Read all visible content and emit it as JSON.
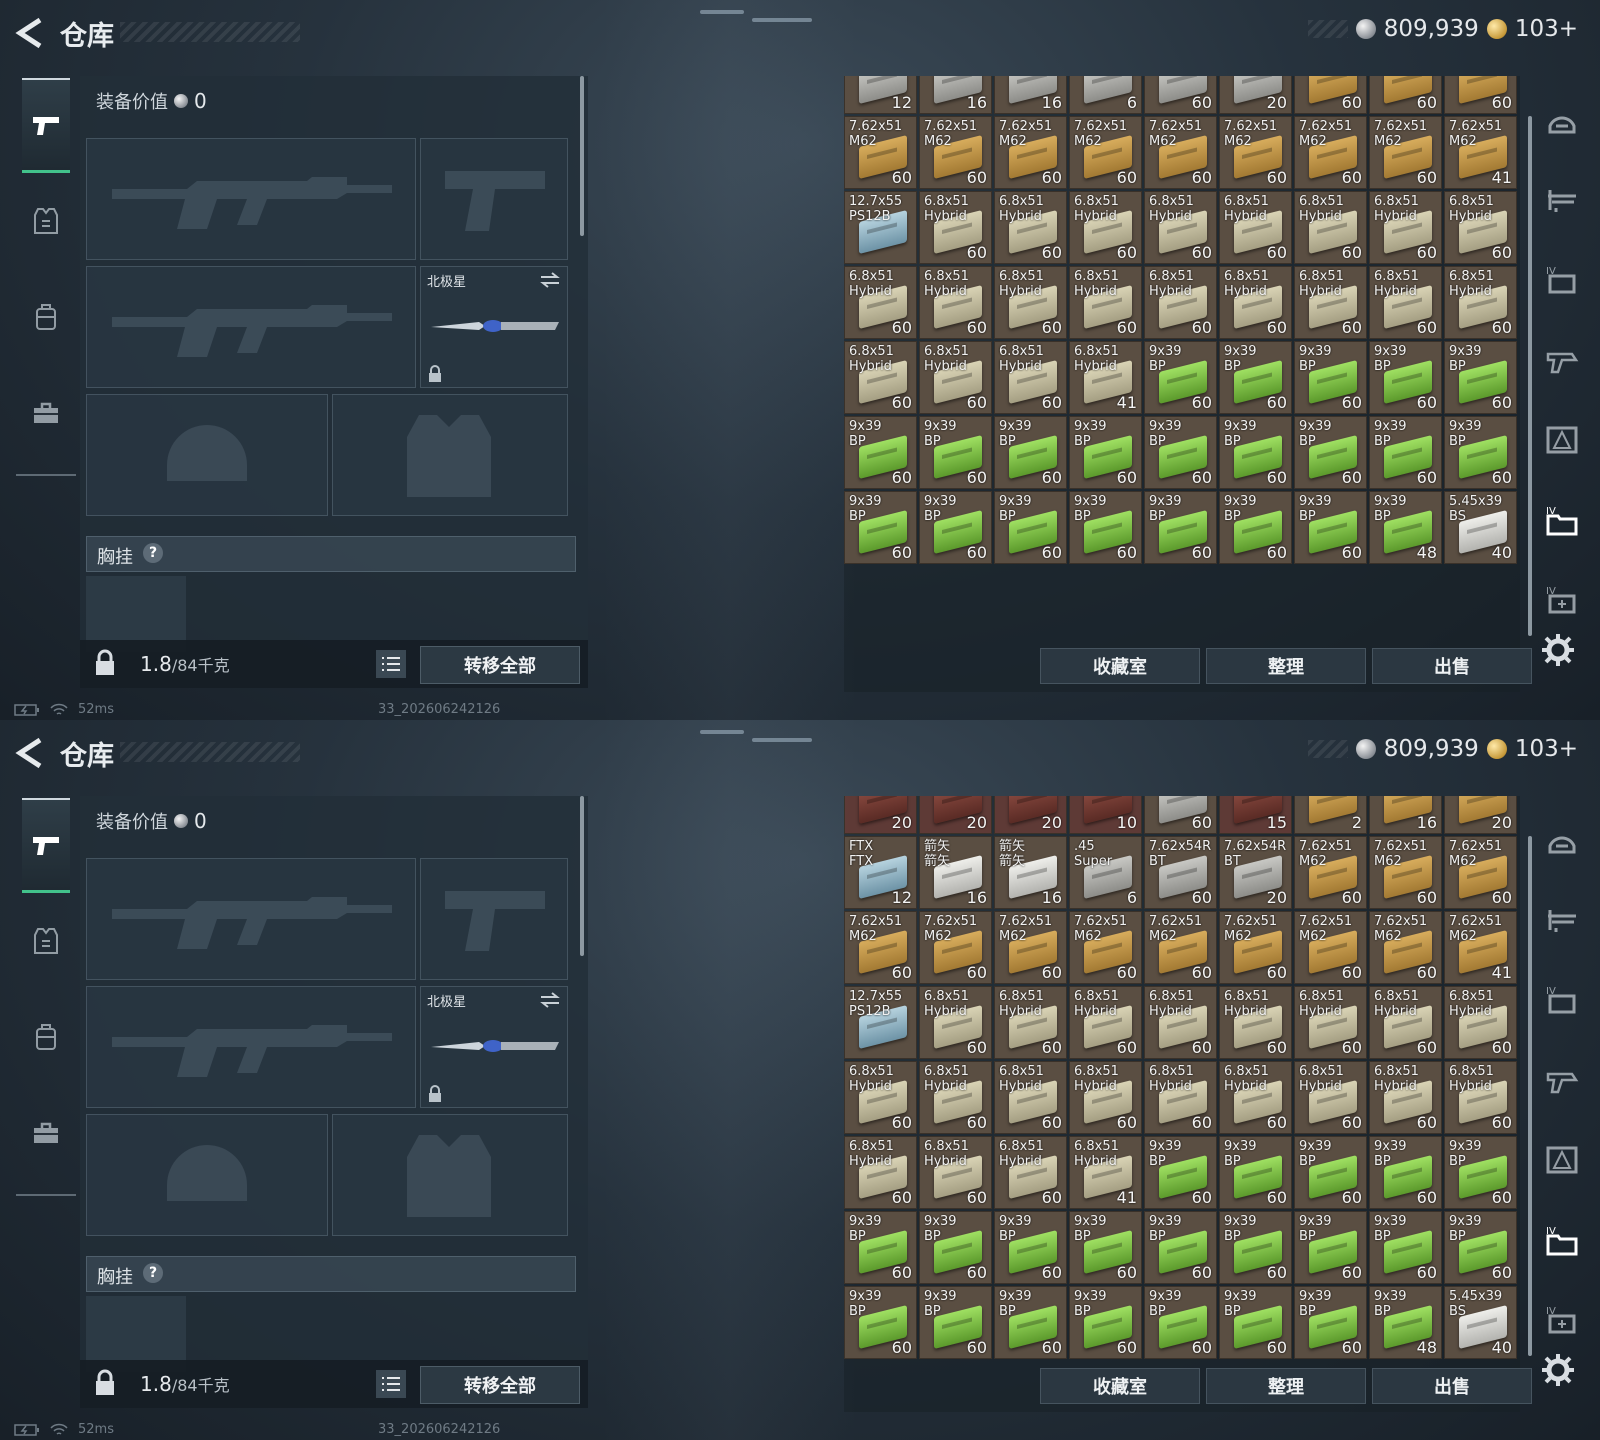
{
  "colors": {
    "accent_green": "#42c28b",
    "ammo_tan": "#b9924f",
    "ammo_green": "#7bbf4a",
    "ammo_gray": "#b8b8b4",
    "ammo_blue": "#8fb2c4",
    "cell_bg": "#5a4e42"
  },
  "screens": [
    {
      "header": {
        "title": "仓库",
        "silver": "809,939",
        "gold": "103+"
      },
      "left_tabs": [
        "pistol-icon",
        "armor-vest-icon",
        "backpack-icon",
        "toolbox-icon"
      ],
      "gear": {
        "value_label": "装备价值",
        "value": "0",
        "melee_name": "北极星",
        "chest_label": "胸挂",
        "chest_hint": "?",
        "weight_current": "1.8",
        "weight_max": "/84千克",
        "transfer_all": "转移全部"
      },
      "status": {
        "ping": "52ms",
        "build": "33_202606242126"
      },
      "storage": {
        "rows": [
          [
            {
              "n": "",
              "c": "12",
              "k": "gray"
            },
            {
              "n": "",
              "c": "16",
              "k": "gray"
            },
            {
              "n": "",
              "c": "16",
              "k": "gray"
            },
            {
              "n": "",
              "c": "6",
              "k": "gray"
            },
            {
              "n": "",
              "c": "60",
              "k": "gray"
            },
            {
              "n": "",
              "c": "20",
              "k": "gray"
            },
            {
              "n": "",
              "c": "60",
              "k": "tan"
            },
            {
              "n": "",
              "c": "60",
              "k": "tan"
            },
            {
              "n": "",
              "c": "60",
              "k": "tan"
            }
          ],
          [
            {
              "n": "7.62x51\nM62",
              "c": "60",
              "k": "tan"
            },
            {
              "n": "7.62x51\nM62",
              "c": "60",
              "k": "tan"
            },
            {
              "n": "7.62x51\nM62",
              "c": "60",
              "k": "tan"
            },
            {
              "n": "7.62x51\nM62",
              "c": "60",
              "k": "tan"
            },
            {
              "n": "7.62x51\nM62",
              "c": "60",
              "k": "tan"
            },
            {
              "n": "7.62x51\nM62",
              "c": "60",
              "k": "tan"
            },
            {
              "n": "7.62x51\nM62",
              "c": "60",
              "k": "tan"
            },
            {
              "n": "7.62x51\nM62",
              "c": "60",
              "k": "tan"
            },
            {
              "n": "7.62x51\nM62",
              "c": "41",
              "k": "tan"
            }
          ],
          [
            {
              "n": "12.7x55\nPS12B",
              "c": "",
              "k": "blue"
            },
            {
              "n": "6.8x51\nHybrid",
              "c": "60",
              "k": "beige"
            },
            {
              "n": "6.8x51\nHybrid",
              "c": "60",
              "k": "beige"
            },
            {
              "n": "6.8x51\nHybrid",
              "c": "60",
              "k": "beige"
            },
            {
              "n": "6.8x51\nHybrid",
              "c": "60",
              "k": "beige"
            },
            {
              "n": "6.8x51\nHybrid",
              "c": "60",
              "k": "beige"
            },
            {
              "n": "6.8x51\nHybrid",
              "c": "60",
              "k": "beige"
            },
            {
              "n": "6.8x51\nHybrid",
              "c": "60",
              "k": "beige"
            },
            {
              "n": "6.8x51\nHybrid",
              "c": "60",
              "k": "beige"
            }
          ],
          [
            {
              "n": "6.8x51\nHybrid",
              "c": "60",
              "k": "beige"
            },
            {
              "n": "6.8x51\nHybrid",
              "c": "60",
              "k": "beige"
            },
            {
              "n": "6.8x51\nHybrid",
              "c": "60",
              "k": "beige"
            },
            {
              "n": "6.8x51\nHybrid",
              "c": "60",
              "k": "beige"
            },
            {
              "n": "6.8x51\nHybrid",
              "c": "60",
              "k": "beige"
            },
            {
              "n": "6.8x51\nHybrid",
              "c": "60",
              "k": "beige"
            },
            {
              "n": "6.8x51\nHybrid",
              "c": "60",
              "k": "beige"
            },
            {
              "n": "6.8x51\nHybrid",
              "c": "60",
              "k": "beige"
            },
            {
              "n": "6.8x51\nHybrid",
              "c": "60",
              "k": "beige"
            }
          ],
          [
            {
              "n": "6.8x51\nHybrid",
              "c": "60",
              "k": "beige"
            },
            {
              "n": "6.8x51\nHybrid",
              "c": "60",
              "k": "beige"
            },
            {
              "n": "6.8x51\nHybrid",
              "c": "60",
              "k": "beige"
            },
            {
              "n": "6.8x51\nHybrid",
              "c": "41",
              "k": "beige"
            },
            {
              "n": "9x39\nBP",
              "c": "60",
              "k": "green"
            },
            {
              "n": "9x39\nBP",
              "c": "60",
              "k": "green"
            },
            {
              "n": "9x39\nBP",
              "c": "60",
              "k": "green"
            },
            {
              "n": "9x39\nBP",
              "c": "60",
              "k": "green"
            },
            {
              "n": "9x39\nBP",
              "c": "60",
              "k": "green"
            }
          ],
          [
            {
              "n": "9x39\nBP",
              "c": "60",
              "k": "green"
            },
            {
              "n": "9x39\nBP",
              "c": "60",
              "k": "green"
            },
            {
              "n": "9x39\nBP",
              "c": "60",
              "k": "green"
            },
            {
              "n": "9x39\nBP",
              "c": "60",
              "k": "green"
            },
            {
              "n": "9x39\nBP",
              "c": "60",
              "k": "green"
            },
            {
              "n": "9x39\nBP",
              "c": "60",
              "k": "green"
            },
            {
              "n": "9x39\nBP",
              "c": "60",
              "k": "green"
            },
            {
              "n": "9x39\nBP",
              "c": "60",
              "k": "green"
            },
            {
              "n": "9x39\nBP",
              "c": "60",
              "k": "green"
            }
          ],
          [
            {
              "n": "9x39\nBP",
              "c": "60",
              "k": "green"
            },
            {
              "n": "9x39\nBP",
              "c": "60",
              "k": "green"
            },
            {
              "n": "9x39\nBP",
              "c": "60",
              "k": "green"
            },
            {
              "n": "9x39\nBP",
              "c": "60",
              "k": "green"
            },
            {
              "n": "9x39\nBP",
              "c": "60",
              "k": "green"
            },
            {
              "n": "9x39\nBP",
              "c": "60",
              "k": "green"
            },
            {
              "n": "9x39\nBP",
              "c": "60",
              "k": "green"
            },
            {
              "n": "9x39\nBP",
              "c": "48",
              "k": "green"
            },
            {
              "n": "5.45x39\nBS",
              "c": "40",
              "k": "white"
            }
          ]
        ],
        "buttons": {
          "collection": "收藏室",
          "sort": "整理",
          "sell": "出售"
        }
      },
      "right_tabs": [
        "helmet-icon",
        "rifle-rack-icon",
        "tier-iv-icon",
        "weapon-parts-icon",
        "warning-box-icon",
        "tier-iv-folder-icon",
        "tier-iv-add-icon"
      ]
    },
    {
      "header": {
        "title": "仓库",
        "silver": "809,939",
        "gold": "103+"
      },
      "left_tabs": [
        "pistol-icon",
        "armor-vest-icon",
        "backpack-icon",
        "toolbox-icon"
      ],
      "gear": {
        "value_label": "装备价值",
        "value": "0",
        "melee_name": "北极星",
        "chest_label": "胸挂",
        "chest_hint": "?",
        "weight_current": "1.8",
        "weight_max": "/84千克",
        "transfer_all": "转移全部"
      },
      "status": {
        "ping": "52ms",
        "build": "33_202606242126"
      },
      "storage": {
        "rows": [
          [
            {
              "n": "",
              "c": "20",
              "k": "red"
            },
            {
              "n": "",
              "c": "20",
              "k": "red"
            },
            {
              "n": "",
              "c": "20",
              "k": "red"
            },
            {
              "n": "",
              "c": "10",
              "k": "red"
            },
            {
              "n": "",
              "c": "60",
              "k": "gray"
            },
            {
              "n": "",
              "c": "15",
              "k": "red"
            },
            {
              "n": "",
              "c": "2",
              "k": "tan"
            },
            {
              "n": "",
              "c": "16",
              "k": "tan"
            },
            {
              "n": "",
              "c": "20",
              "k": "tan"
            }
          ],
          [
            {
              "n": "FTX\nFTX",
              "c": "12",
              "k": "blue"
            },
            {
              "n": "箭矢\n箭矢",
              "c": "16",
              "k": "white"
            },
            {
              "n": "箭矢\n箭矢",
              "c": "16",
              "k": "white"
            },
            {
              "n": ".45\nSuper",
              "c": "6",
              "k": "gray"
            },
            {
              "n": "7.62x54R\nBT",
              "c": "60",
              "k": "gray"
            },
            {
              "n": "7.62x54R\nBT",
              "c": "20",
              "k": "gray"
            },
            {
              "n": "7.62x51\nM62",
              "c": "60",
              "k": "tan"
            },
            {
              "n": "7.62x51\nM62",
              "c": "60",
              "k": "tan"
            },
            {
              "n": "7.62x51\nM62",
              "c": "60",
              "k": "tan"
            }
          ],
          [
            {
              "n": "7.62x51\nM62",
              "c": "60",
              "k": "tan"
            },
            {
              "n": "7.62x51\nM62",
              "c": "60",
              "k": "tan"
            },
            {
              "n": "7.62x51\nM62",
              "c": "60",
              "k": "tan"
            },
            {
              "n": "7.62x51\nM62",
              "c": "60",
              "k": "tan"
            },
            {
              "n": "7.62x51\nM62",
              "c": "60",
              "k": "tan"
            },
            {
              "n": "7.62x51\nM62",
              "c": "60",
              "k": "tan"
            },
            {
              "n": "7.62x51\nM62",
              "c": "60",
              "k": "tan"
            },
            {
              "n": "7.62x51\nM62",
              "c": "60",
              "k": "tan"
            },
            {
              "n": "7.62x51\nM62",
              "c": "41",
              "k": "tan"
            }
          ],
          [
            {
              "n": "12.7x55\nPS12B",
              "c": "",
              "k": "blue"
            },
            {
              "n": "6.8x51\nHybrid",
              "c": "60",
              "k": "beige"
            },
            {
              "n": "6.8x51\nHybrid",
              "c": "60",
              "k": "beige"
            },
            {
              "n": "6.8x51\nHybrid",
              "c": "60",
              "k": "beige"
            },
            {
              "n": "6.8x51\nHybrid",
              "c": "60",
              "k": "beige"
            },
            {
              "n": "6.8x51\nHybrid",
              "c": "60",
              "k": "beige"
            },
            {
              "n": "6.8x51\nHybrid",
              "c": "60",
              "k": "beige"
            },
            {
              "n": "6.8x51\nHybrid",
              "c": "60",
              "k": "beige"
            },
            {
              "n": "6.8x51\nHybrid",
              "c": "60",
              "k": "beige"
            }
          ],
          [
            {
              "n": "6.8x51\nHybrid",
              "c": "60",
              "k": "beige"
            },
            {
              "n": "6.8x51\nHybrid",
              "c": "60",
              "k": "beige"
            },
            {
              "n": "6.8x51\nHybrid",
              "c": "60",
              "k": "beige"
            },
            {
              "n": "6.8x51\nHybrid",
              "c": "60",
              "k": "beige"
            },
            {
              "n": "6.8x51\nHybrid",
              "c": "60",
              "k": "beige"
            },
            {
              "n": "6.8x51\nHybrid",
              "c": "60",
              "k": "beige"
            },
            {
              "n": "6.8x51\nHybrid",
              "c": "60",
              "k": "beige"
            },
            {
              "n": "6.8x51\nHybrid",
              "c": "60",
              "k": "beige"
            },
            {
              "n": "6.8x51\nHybrid",
              "c": "60",
              "k": "beige"
            }
          ],
          [
            {
              "n": "6.8x51\nHybrid",
              "c": "60",
              "k": "beige"
            },
            {
              "n": "6.8x51\nHybrid",
              "c": "60",
              "k": "beige"
            },
            {
              "n": "6.8x51\nHybrid",
              "c": "60",
              "k": "beige"
            },
            {
              "n": "6.8x51\nHybrid",
              "c": "41",
              "k": "beige"
            },
            {
              "n": "9x39\nBP",
              "c": "60",
              "k": "green"
            },
            {
              "n": "9x39\nBP",
              "c": "60",
              "k": "green"
            },
            {
              "n": "9x39\nBP",
              "c": "60",
              "k": "green"
            },
            {
              "n": "9x39\nBP",
              "c": "60",
              "k": "green"
            },
            {
              "n": "9x39\nBP",
              "c": "60",
              "k": "green"
            }
          ],
          [
            {
              "n": "9x39\nBP",
              "c": "60",
              "k": "green"
            },
            {
              "n": "9x39\nBP",
              "c": "60",
              "k": "green"
            },
            {
              "n": "9x39\nBP",
              "c": "60",
              "k": "green"
            },
            {
              "n": "9x39\nBP",
              "c": "60",
              "k": "green"
            },
            {
              "n": "9x39\nBP",
              "c": "60",
              "k": "green"
            },
            {
              "n": "9x39\nBP",
              "c": "60",
              "k": "green"
            },
            {
              "n": "9x39\nBP",
              "c": "60",
              "k": "green"
            },
            {
              "n": "9x39\nBP",
              "c": "60",
              "k": "green"
            },
            {
              "n": "9x39\nBP",
              "c": "60",
              "k": "green"
            }
          ],
          [
            {
              "n": "9x39\nBP",
              "c": "60",
              "k": "green"
            },
            {
              "n": "9x39\nBP",
              "c": "60",
              "k": "green"
            },
            {
              "n": "9x39\nBP",
              "c": "60",
              "k": "green"
            },
            {
              "n": "9x39\nBP",
              "c": "60",
              "k": "green"
            },
            {
              "n": "9x39\nBP",
              "c": "60",
              "k": "green"
            },
            {
              "n": "9x39\nBP",
              "c": "60",
              "k": "green"
            },
            {
              "n": "9x39\nBP",
              "c": "60",
              "k": "green"
            },
            {
              "n": "9x39\nBP",
              "c": "48",
              "k": "green"
            },
            {
              "n": "5.45x39\nBS",
              "c": "40",
              "k": "white"
            }
          ]
        ],
        "buttons": {
          "collection": "收藏室",
          "sort": "整理",
          "sell": "出售"
        }
      },
      "right_tabs": [
        "helmet-icon",
        "rifle-rack-icon",
        "tier-iv-icon",
        "weapon-parts-icon",
        "warning-box-icon",
        "tier-iv-folder-icon",
        "tier-iv-add-icon"
      ]
    }
  ]
}
